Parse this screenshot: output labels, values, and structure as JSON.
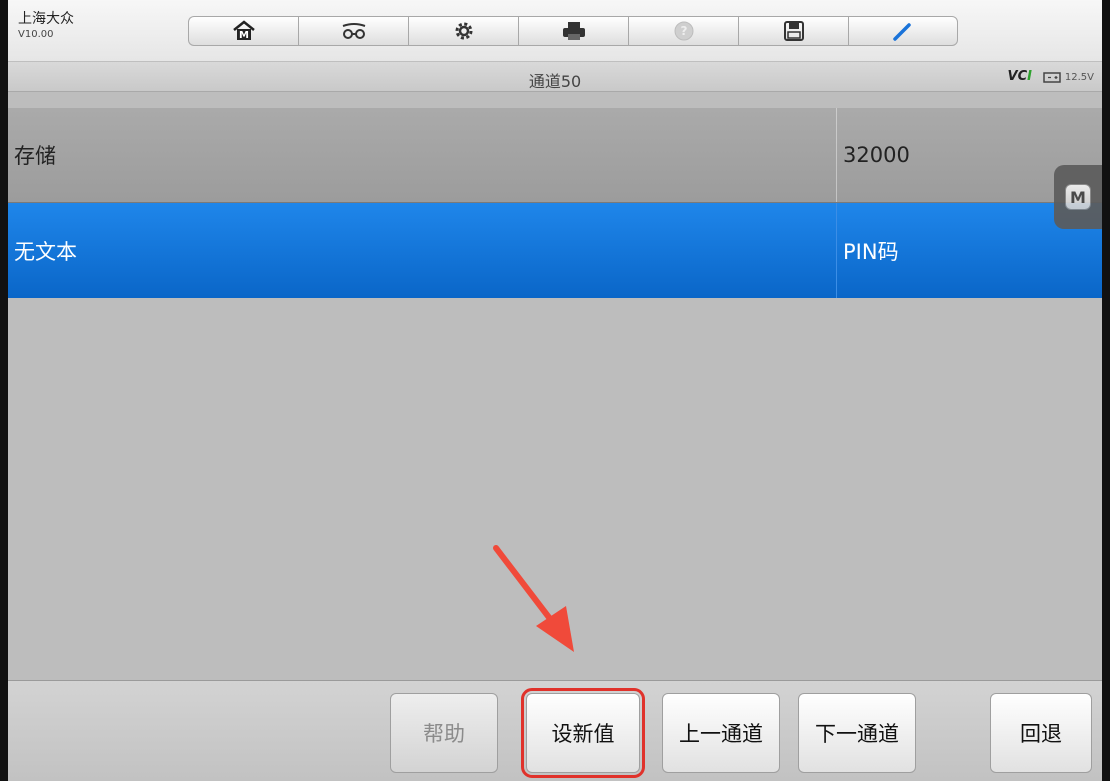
{
  "header": {
    "brand_title": "上海大众",
    "version": "V10.00",
    "toolbar_icons": [
      "home-icon",
      "vehicle-tools-icon",
      "gear-icon",
      "printer-icon",
      "help-icon",
      "save-icon",
      "pen-icon"
    ]
  },
  "status": {
    "channel_title": "通道50",
    "vci_label_a": "VC",
    "vci_label_b": "I",
    "battery_voltage": "12.5V"
  },
  "table": {
    "rows": [
      {
        "label": "存储",
        "value": "32000",
        "selected": false
      },
      {
        "label": "无文本",
        "value": "PIN码",
        "selected": true
      }
    ]
  },
  "float_button": {
    "label": "M"
  },
  "bottom": {
    "help": "帮助",
    "set_new_value": "设新值",
    "prev_channel": "上一通道",
    "next_channel": "下一通道",
    "back": "回退"
  },
  "colors": {
    "selected_row": "#1677db",
    "highlight_box": "#e0322b",
    "arrow": "#f04a3a"
  }
}
